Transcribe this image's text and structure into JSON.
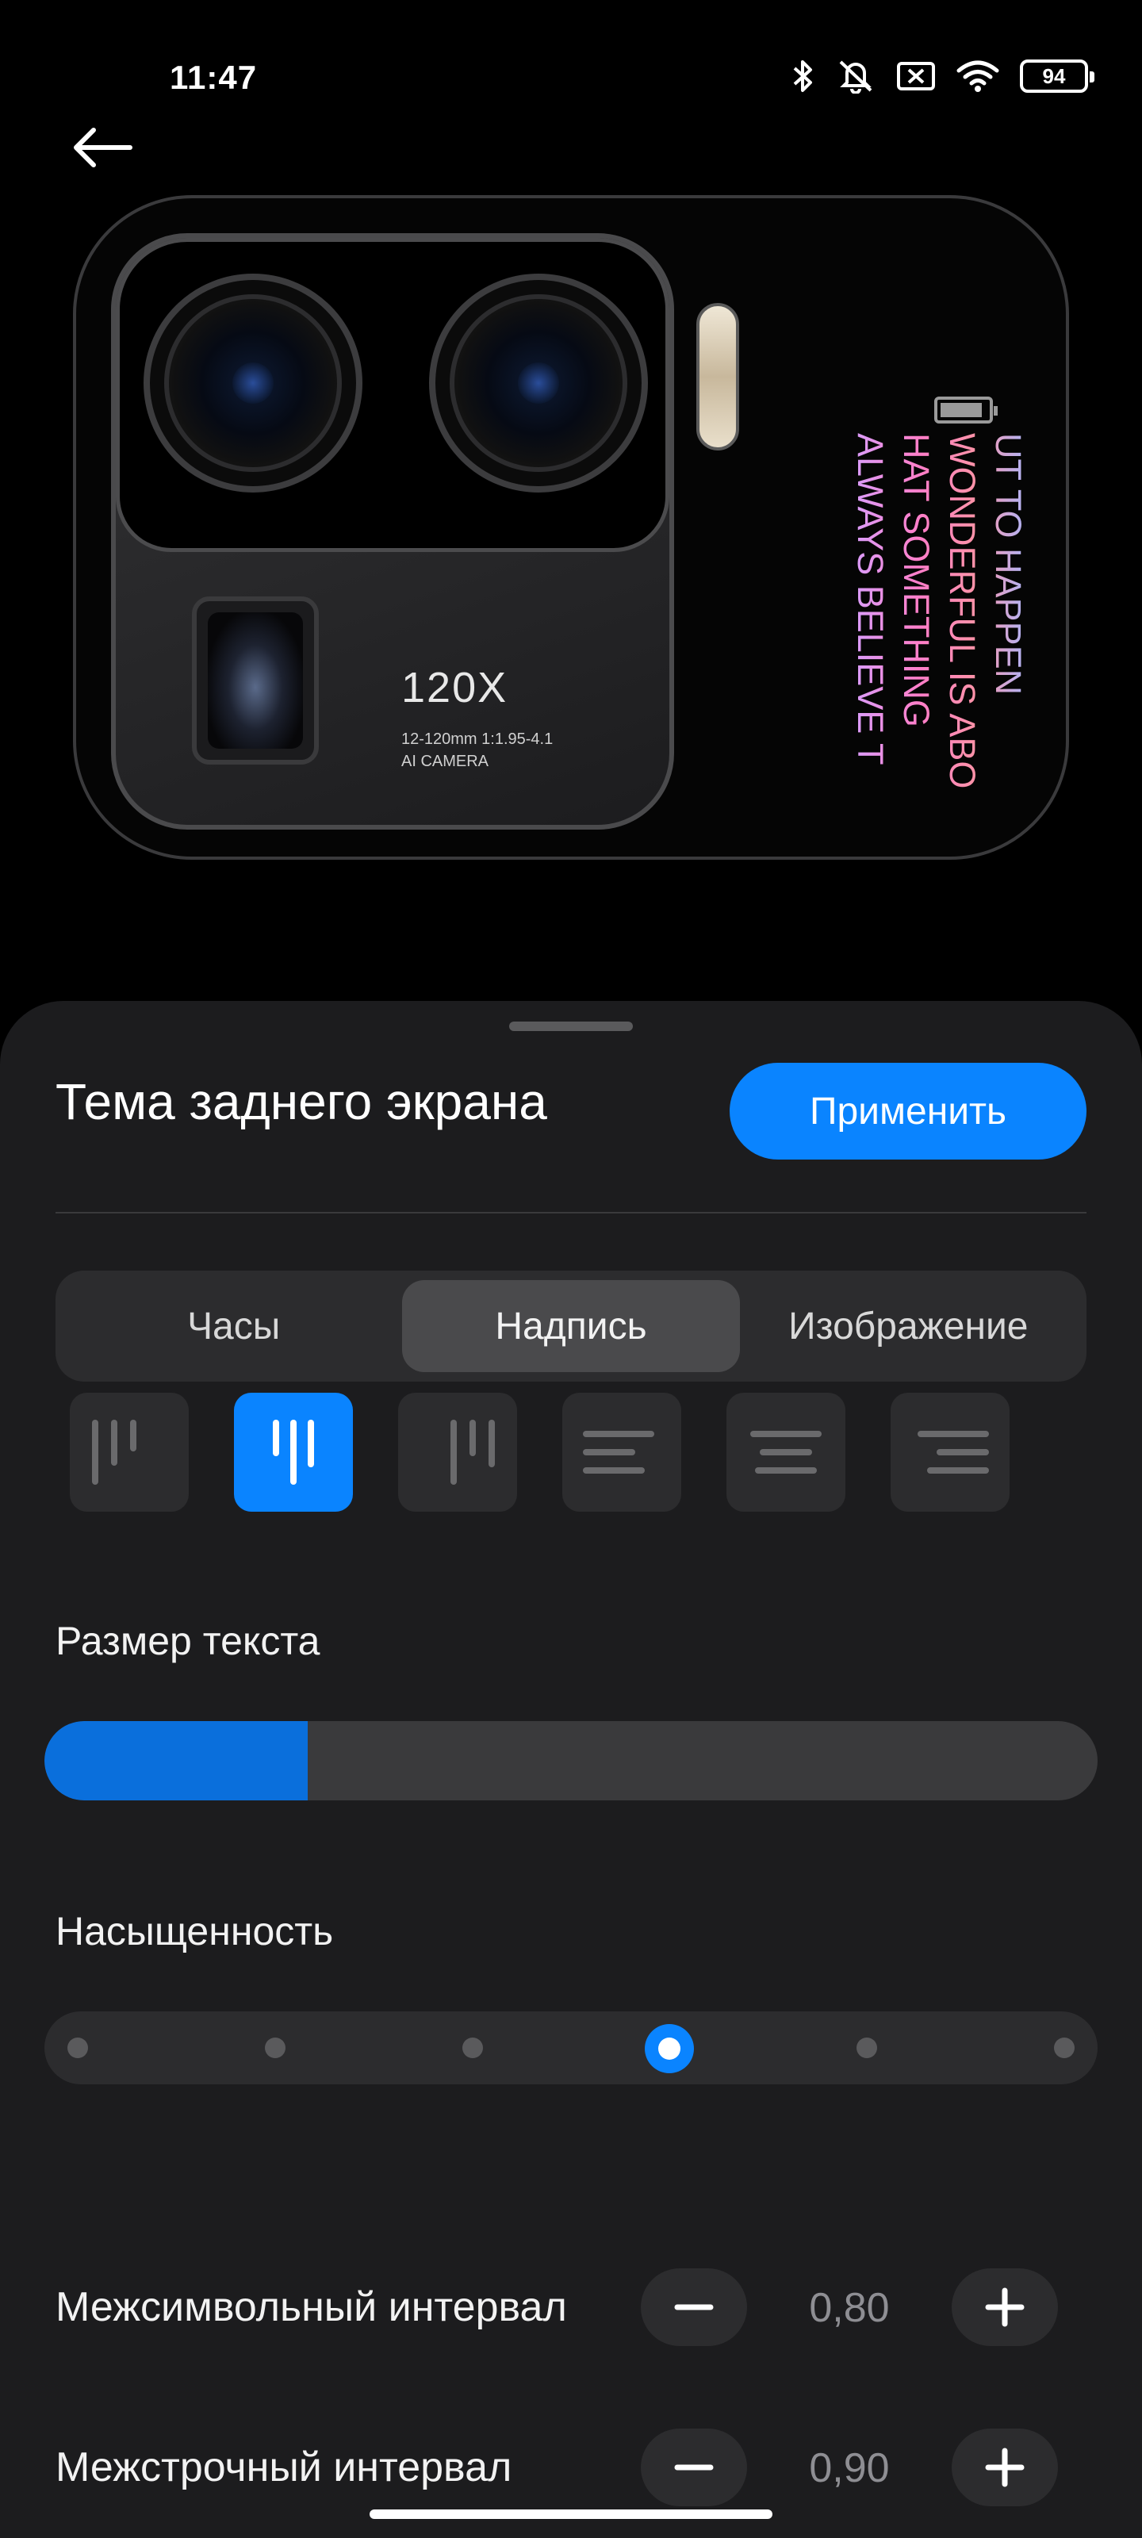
{
  "status_bar": {
    "time": "11:47",
    "battery": "94",
    "icons": [
      "bluetooth-icon",
      "vibrate-off-icon",
      "no-sim-icon",
      "wifi-icon",
      "battery-icon"
    ]
  },
  "preview": {
    "zoom_title": "120X",
    "zoom_spec_line1": "12-120mm  1:1.95-4.1",
    "zoom_spec_line2": "AI CAMERA",
    "quote_lines": [
      "ALWAYS BELIEVE T",
      "HAT SOMETHING",
      "WONDERFUL IS ABO",
      "UT TO HAPPEN"
    ]
  },
  "sheet": {
    "title": "Тема заднего экрана",
    "apply_label": "Применить",
    "tabs": [
      {
        "label": "Часы",
        "active": false
      },
      {
        "label": "Надпись",
        "active": true
      },
      {
        "label": "Изображение",
        "active": false
      }
    ],
    "alignment_options": [
      "vertical-left",
      "vertical-center",
      "vertical-right",
      "horizontal-left",
      "horizontal-center",
      "horizontal-right"
    ],
    "alignment_selected": 1,
    "text_size_label": "Размер текста",
    "text_size_fraction": 0.25,
    "saturation_label": "Насыщенность",
    "saturation_steps": 6,
    "saturation_selected_index": 3,
    "letter_spacing": {
      "label": "Межсимвольный интервал",
      "value": "0,80"
    },
    "line_spacing": {
      "label": "Межстрочный интервал",
      "value": "0,90"
    }
  },
  "colors": {
    "accent": "#0a84ff",
    "sheet_bg": "#1c1c1e",
    "control_bg": "#2c2c2e"
  }
}
